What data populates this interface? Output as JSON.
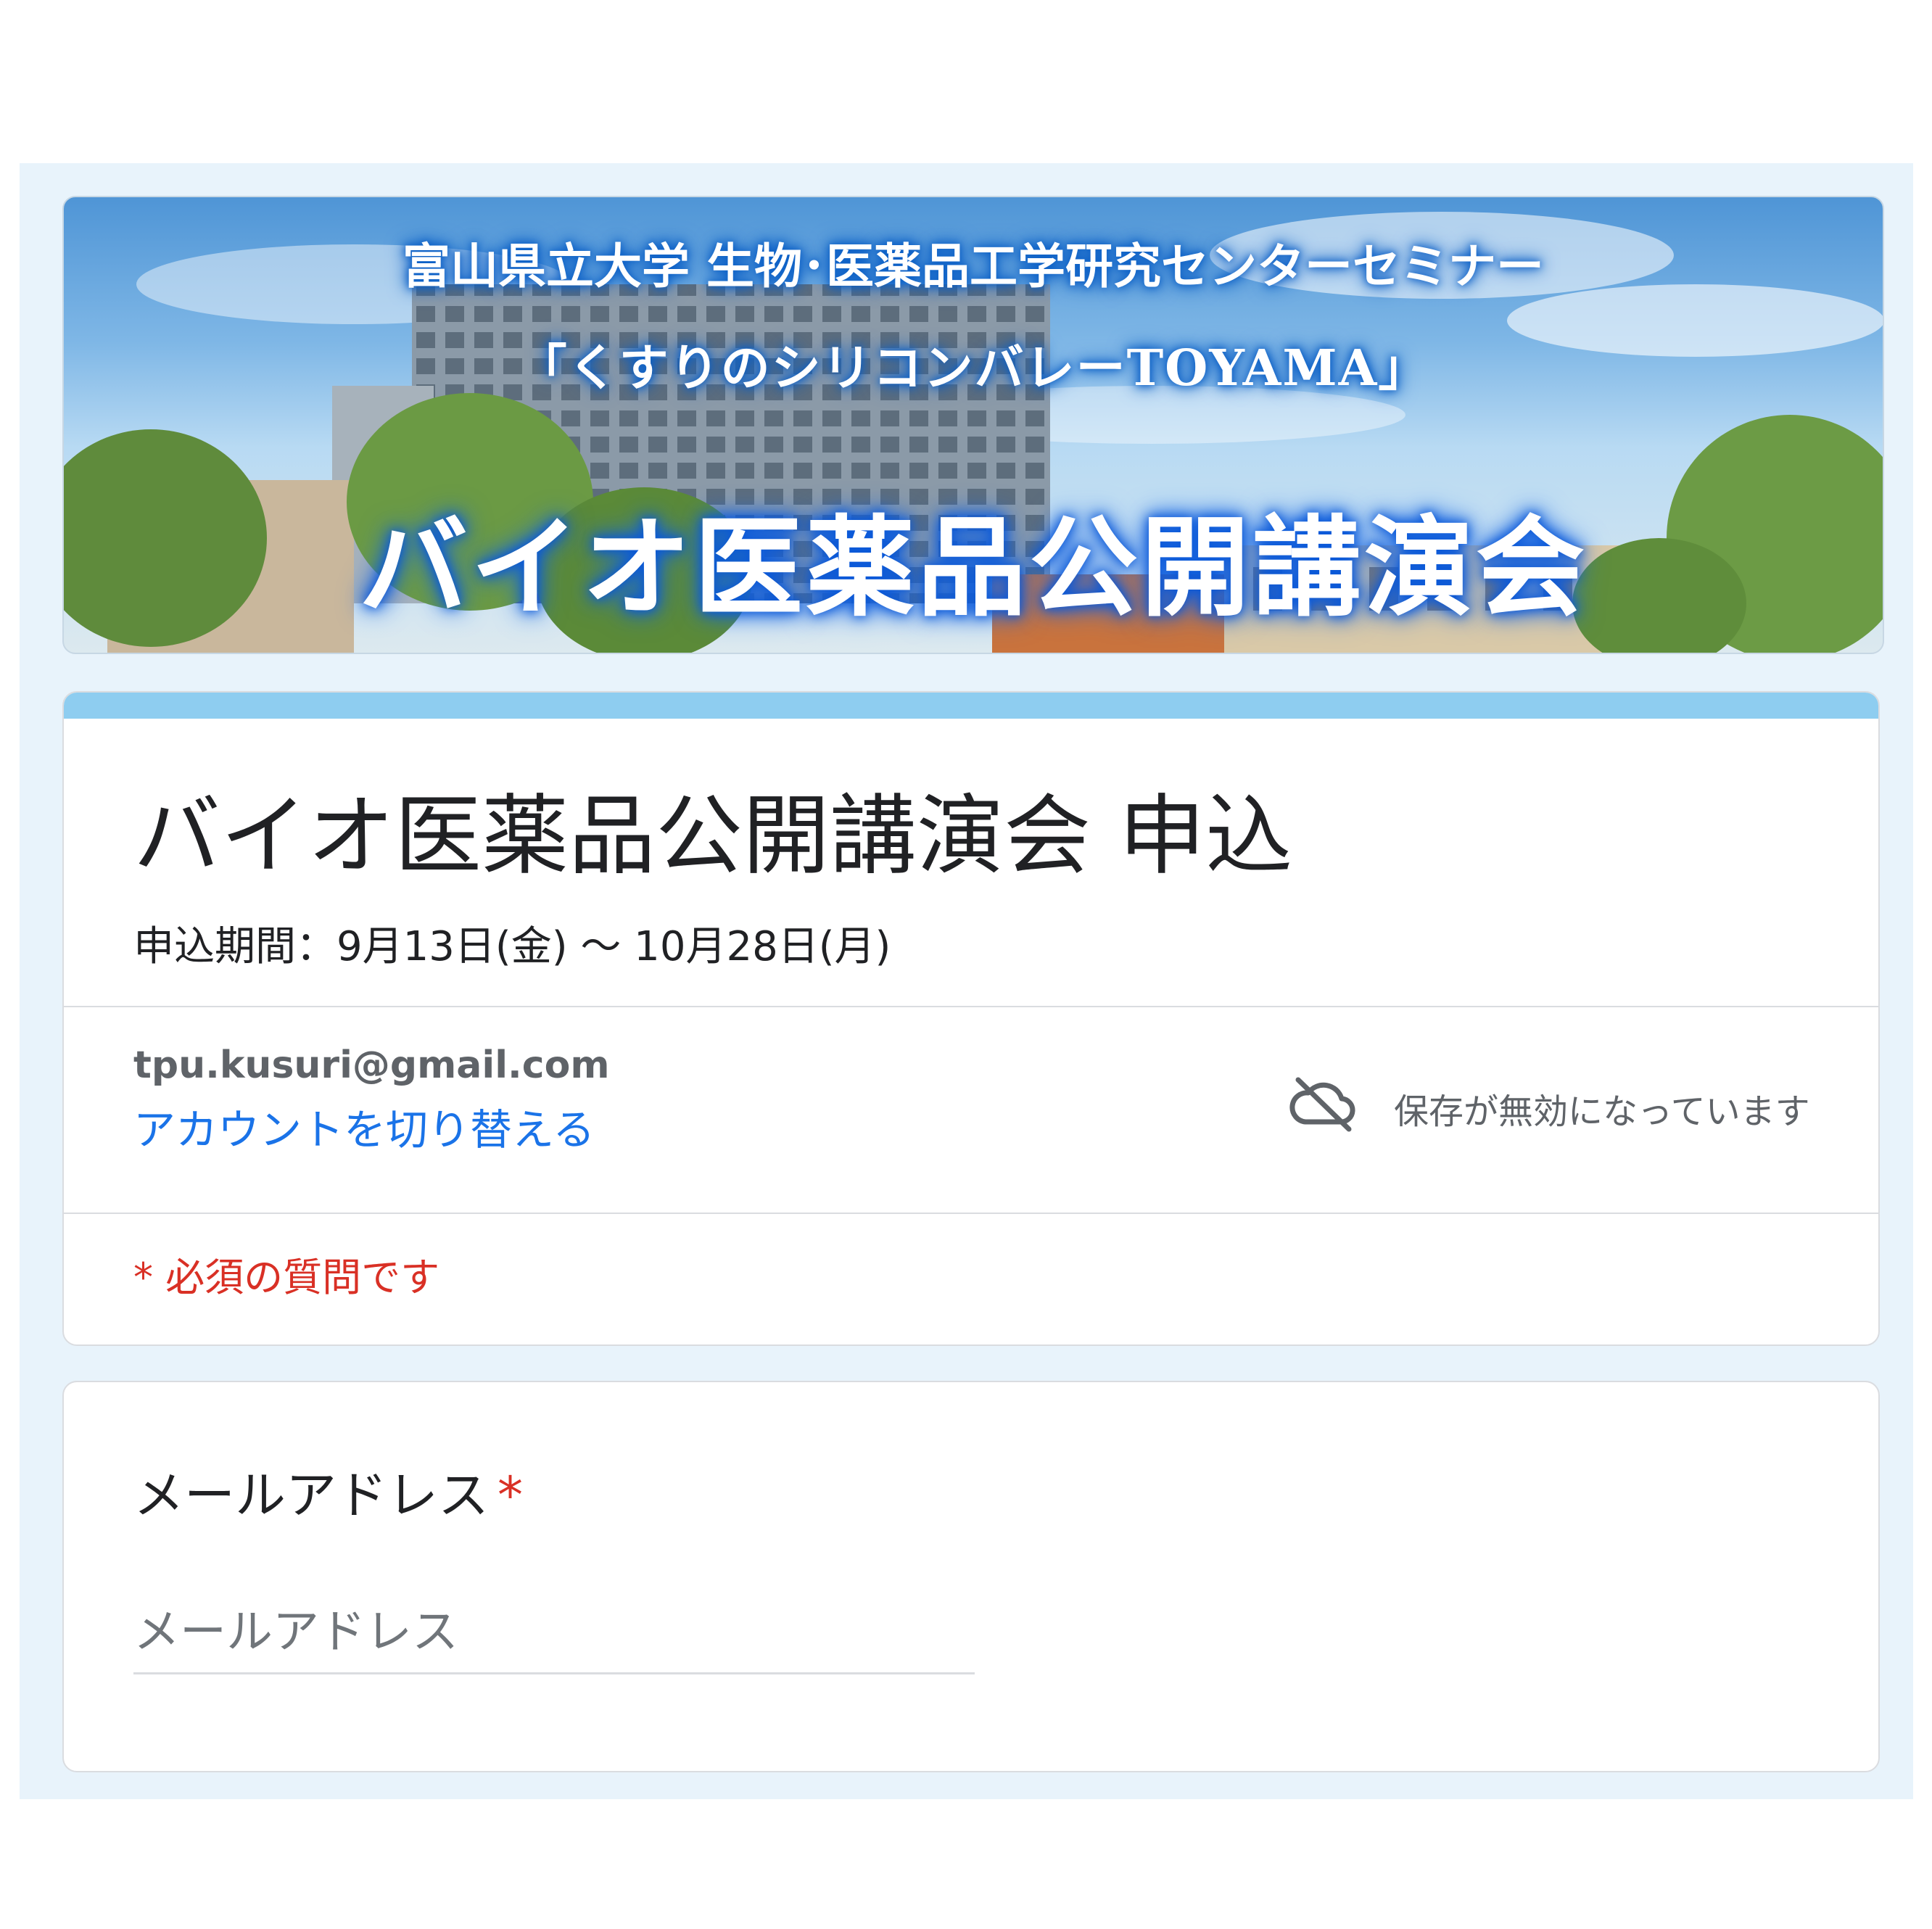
{
  "banner": {
    "line1": "富山県立大学 生物･医薬品工学研究センターセミナー",
    "line2": "「くすりのシリコンバレーTOYAMA」",
    "line3": "バイオ医薬品公開講演会"
  },
  "header": {
    "title": "バイオ医薬品公開講演会 申込",
    "period": "申込期間：9月13日(金) ～ 10月28日(月)",
    "accent_color": "#8ecdf0"
  },
  "account": {
    "email": "tpu.kusuri@gmail.com",
    "switch_label": "アカウントを切り替える",
    "save_status": "保存が無効になっています",
    "save_icon": "cloud-off-icon"
  },
  "required_note": "* 必須の質問です",
  "question": {
    "label": "メールアドレス",
    "required_mark": "*",
    "placeholder": "メールアドレス",
    "value": ""
  }
}
